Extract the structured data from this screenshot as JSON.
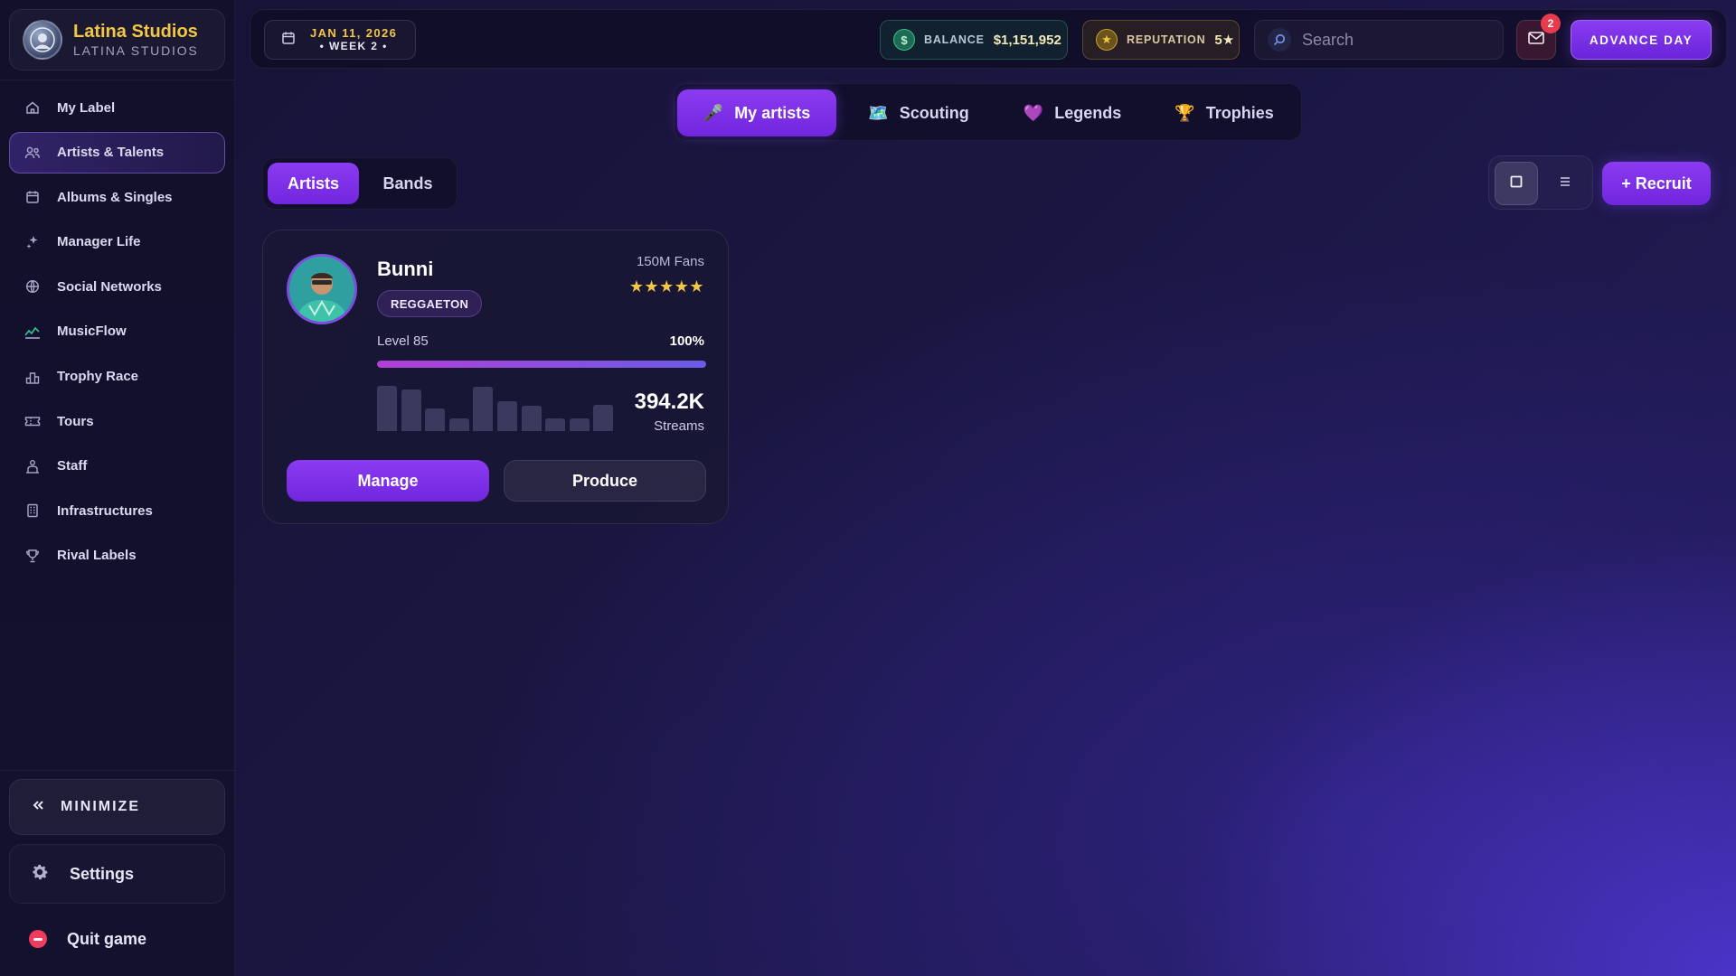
{
  "brand": {
    "name": "Latina Studios",
    "subtitle": "LATINA STUDIOS"
  },
  "sidebar": {
    "items": [
      {
        "label": "My Label",
        "icon": "home-icon",
        "active": false
      },
      {
        "label": "Artists & Talents",
        "icon": "users-icon",
        "active": true
      },
      {
        "label": "Albums & Singles",
        "icon": "calendar-icon",
        "active": false
      },
      {
        "label": "Manager Life",
        "icon": "sparkle-icon",
        "active": false
      },
      {
        "label": "Social Networks",
        "icon": "globe-icon",
        "active": false
      },
      {
        "label": "MusicFlow",
        "icon": "chart-icon",
        "active": false
      },
      {
        "label": "Trophy Race",
        "icon": "podium-icon",
        "active": false
      },
      {
        "label": "Tours",
        "icon": "ticket-icon",
        "active": false
      },
      {
        "label": "Staff",
        "icon": "staff-icon",
        "active": false
      },
      {
        "label": "Infrastructures",
        "icon": "building-icon",
        "active": false
      },
      {
        "label": "Rival Labels",
        "icon": "trophy-icon",
        "active": false
      }
    ],
    "minimize_label": "MINIMIZE",
    "settings_label": "Settings",
    "quit_label": "Quit game"
  },
  "topbar": {
    "date": "JAN 11, 2026",
    "week": "• WEEK 2 •",
    "balance_label": "BALANCE",
    "balance_value": "$1,151,952",
    "reputation_label": "REPUTATION",
    "reputation_value": "5★",
    "search_placeholder": "Search",
    "mail_count": "2",
    "advance_label": "ADVANCE DAY"
  },
  "main_tabs": [
    {
      "label": "My artists",
      "emoji": "🎤",
      "active": true
    },
    {
      "label": "Scouting",
      "emoji": "🗺️",
      "active": false
    },
    {
      "label": "Legends",
      "emoji": "💜",
      "active": false
    },
    {
      "label": "Trophies",
      "emoji": "🏆",
      "active": false
    }
  ],
  "sub_tabs": [
    {
      "label": "Artists",
      "active": true
    },
    {
      "label": "Bands",
      "active": false
    }
  ],
  "recruit_label": "+ Recruit",
  "view_mode": "grid",
  "artist": {
    "name": "Bunni",
    "genre": "REGGAETON",
    "fans": "150M Fans",
    "stars": "★★★★★",
    "level": "Level 85",
    "level_pct_label": "100%",
    "progress": 1.0,
    "stream_history": [
      1.0,
      0.92,
      0.5,
      0.28,
      0.98,
      0.66,
      0.56,
      0.28,
      0.28,
      0.58
    ],
    "streams_value": "394.2K",
    "streams_label": "Streams",
    "manage_label": "Manage",
    "produce_label": "Produce"
  },
  "colors": {
    "accent": "#7c2fe6",
    "gold": "#f3c744",
    "danger": "#e83b4e"
  }
}
